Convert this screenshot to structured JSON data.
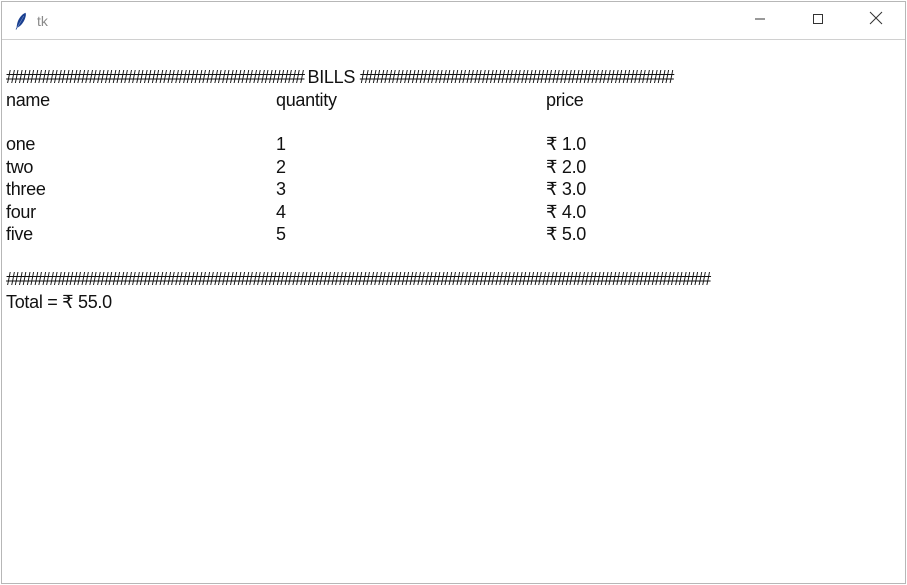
{
  "window": {
    "title": "tk"
  },
  "bill": {
    "header_left_hashes": "######################################",
    "header_title": "BILLS",
    "header_right_hashes": "########################################",
    "columns": {
      "name": "name",
      "quantity": "quantity",
      "price": "price"
    },
    "rows": [
      {
        "name": "one",
        "quantity": "1",
        "price": "₹ 1.0"
      },
      {
        "name": "two",
        "quantity": "2",
        "price": "₹ 2.0"
      },
      {
        "name": "three",
        "quantity": "3",
        "price": "₹ 3.0"
      },
      {
        "name": "four",
        "quantity": "4",
        "price": "₹ 4.0"
      },
      {
        "name": "five",
        "quantity": "5",
        "price": "₹ 5.0"
      }
    ],
    "footer_hashes": "##########################################################################################",
    "total": "Total = ₹ 55.0"
  },
  "colors": {
    "text": "#111111",
    "title_text": "#8a8a8a",
    "titlebar_border": "#d0d0d0"
  },
  "icons": {
    "app": "feather-icon",
    "minimize": "minimize-icon",
    "maximize": "maximize-icon",
    "close": "close-icon"
  }
}
